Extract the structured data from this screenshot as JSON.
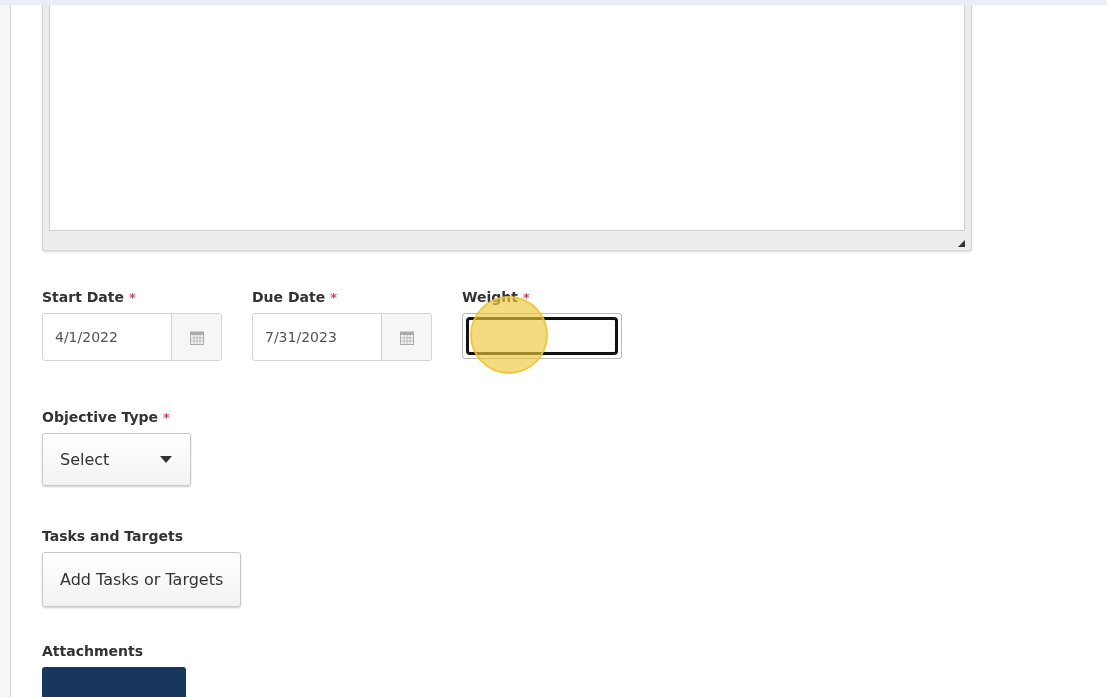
{
  "description_box": {
    "resizable": true
  },
  "date_fields": [
    {
      "label": "Start Date",
      "marker": "*",
      "value": "4/1/2022"
    },
    {
      "label": "Due Date",
      "marker": "*",
      "value": "7/31/2023"
    }
  ],
  "weight_field": {
    "label": "Weight",
    "marker": "*",
    "focused": true
  },
  "objective_type": {
    "label": "Objective Type",
    "marker": "*",
    "value": "Select"
  },
  "tasks": {
    "label": "Tasks and Targets",
    "button": "Add Tasks or Targets"
  },
  "attachments": {
    "label": "Attachments"
  }
}
